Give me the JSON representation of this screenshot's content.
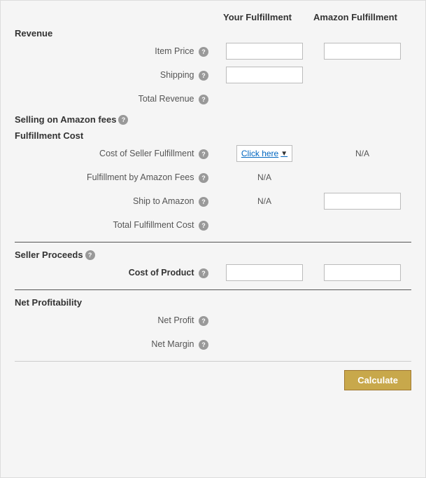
{
  "header": {
    "col_your": "Your Fulfillment",
    "col_amazon": "Amazon Fulfillment"
  },
  "sections": {
    "revenue_title": "Revenue",
    "item_price_label": "Item Price",
    "shipping_label": "Shipping",
    "total_revenue_label": "Total Revenue",
    "selling_fees_title": "Selling on Amazon fees",
    "fulfillment_cost_title": "Fulfillment Cost",
    "cost_seller_label": "Cost of Seller Fulfillment",
    "click_here_label": "Click here",
    "fulfillment_amazon_label": "Fulfillment by Amazon Fees",
    "ship_amazon_label": "Ship to Amazon",
    "total_fulfillment_label": "Total Fulfillment Cost",
    "seller_proceeds_title": "Seller Proceeds",
    "cost_product_title": "Cost of Product",
    "net_profitability_title": "Net Profitability",
    "net_profit_label": "Net Profit",
    "net_margin_label": "Net Margin",
    "calculate_label": "Calculate",
    "na": "N/A"
  }
}
